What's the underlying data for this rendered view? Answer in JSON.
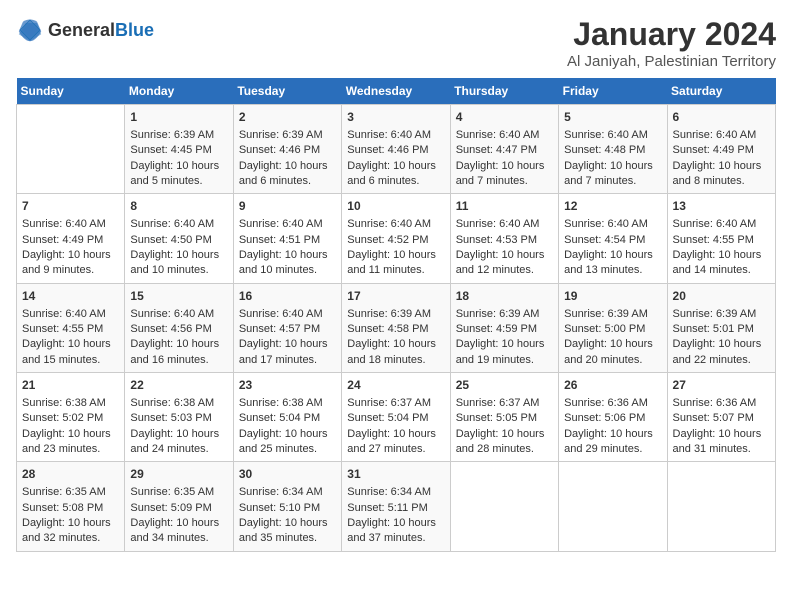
{
  "header": {
    "logo_general": "General",
    "logo_blue": "Blue",
    "month": "January 2024",
    "location": "Al Janiyah, Palestinian Territory"
  },
  "weekdays": [
    "Sunday",
    "Monday",
    "Tuesday",
    "Wednesday",
    "Thursday",
    "Friday",
    "Saturday"
  ],
  "weeks": [
    [
      {
        "day": "",
        "info": ""
      },
      {
        "day": "1",
        "info": "Sunrise: 6:39 AM\nSunset: 4:45 PM\nDaylight: 10 hours\nand 5 minutes."
      },
      {
        "day": "2",
        "info": "Sunrise: 6:39 AM\nSunset: 4:46 PM\nDaylight: 10 hours\nand 6 minutes."
      },
      {
        "day": "3",
        "info": "Sunrise: 6:40 AM\nSunset: 4:46 PM\nDaylight: 10 hours\nand 6 minutes."
      },
      {
        "day": "4",
        "info": "Sunrise: 6:40 AM\nSunset: 4:47 PM\nDaylight: 10 hours\nand 7 minutes."
      },
      {
        "day": "5",
        "info": "Sunrise: 6:40 AM\nSunset: 4:48 PM\nDaylight: 10 hours\nand 7 minutes."
      },
      {
        "day": "6",
        "info": "Sunrise: 6:40 AM\nSunset: 4:49 PM\nDaylight: 10 hours\nand 8 minutes."
      }
    ],
    [
      {
        "day": "7",
        "info": "Sunrise: 6:40 AM\nSunset: 4:49 PM\nDaylight: 10 hours\nand 9 minutes."
      },
      {
        "day": "8",
        "info": "Sunrise: 6:40 AM\nSunset: 4:50 PM\nDaylight: 10 hours\nand 10 minutes."
      },
      {
        "day": "9",
        "info": "Sunrise: 6:40 AM\nSunset: 4:51 PM\nDaylight: 10 hours\nand 10 minutes."
      },
      {
        "day": "10",
        "info": "Sunrise: 6:40 AM\nSunset: 4:52 PM\nDaylight: 10 hours\nand 11 minutes."
      },
      {
        "day": "11",
        "info": "Sunrise: 6:40 AM\nSunset: 4:53 PM\nDaylight: 10 hours\nand 12 minutes."
      },
      {
        "day": "12",
        "info": "Sunrise: 6:40 AM\nSunset: 4:54 PM\nDaylight: 10 hours\nand 13 minutes."
      },
      {
        "day": "13",
        "info": "Sunrise: 6:40 AM\nSunset: 4:55 PM\nDaylight: 10 hours\nand 14 minutes."
      }
    ],
    [
      {
        "day": "14",
        "info": "Sunrise: 6:40 AM\nSunset: 4:55 PM\nDaylight: 10 hours\nand 15 minutes."
      },
      {
        "day": "15",
        "info": "Sunrise: 6:40 AM\nSunset: 4:56 PM\nDaylight: 10 hours\nand 16 minutes."
      },
      {
        "day": "16",
        "info": "Sunrise: 6:40 AM\nSunset: 4:57 PM\nDaylight: 10 hours\nand 17 minutes."
      },
      {
        "day": "17",
        "info": "Sunrise: 6:39 AM\nSunset: 4:58 PM\nDaylight: 10 hours\nand 18 minutes."
      },
      {
        "day": "18",
        "info": "Sunrise: 6:39 AM\nSunset: 4:59 PM\nDaylight: 10 hours\nand 19 minutes."
      },
      {
        "day": "19",
        "info": "Sunrise: 6:39 AM\nSunset: 5:00 PM\nDaylight: 10 hours\nand 20 minutes."
      },
      {
        "day": "20",
        "info": "Sunrise: 6:39 AM\nSunset: 5:01 PM\nDaylight: 10 hours\nand 22 minutes."
      }
    ],
    [
      {
        "day": "21",
        "info": "Sunrise: 6:38 AM\nSunset: 5:02 PM\nDaylight: 10 hours\nand 23 minutes."
      },
      {
        "day": "22",
        "info": "Sunrise: 6:38 AM\nSunset: 5:03 PM\nDaylight: 10 hours\nand 24 minutes."
      },
      {
        "day": "23",
        "info": "Sunrise: 6:38 AM\nSunset: 5:04 PM\nDaylight: 10 hours\nand 25 minutes."
      },
      {
        "day": "24",
        "info": "Sunrise: 6:37 AM\nSunset: 5:04 PM\nDaylight: 10 hours\nand 27 minutes."
      },
      {
        "day": "25",
        "info": "Sunrise: 6:37 AM\nSunset: 5:05 PM\nDaylight: 10 hours\nand 28 minutes."
      },
      {
        "day": "26",
        "info": "Sunrise: 6:36 AM\nSunset: 5:06 PM\nDaylight: 10 hours\nand 29 minutes."
      },
      {
        "day": "27",
        "info": "Sunrise: 6:36 AM\nSunset: 5:07 PM\nDaylight: 10 hours\nand 31 minutes."
      }
    ],
    [
      {
        "day": "28",
        "info": "Sunrise: 6:35 AM\nSunset: 5:08 PM\nDaylight: 10 hours\nand 32 minutes."
      },
      {
        "day": "29",
        "info": "Sunrise: 6:35 AM\nSunset: 5:09 PM\nDaylight: 10 hours\nand 34 minutes."
      },
      {
        "day": "30",
        "info": "Sunrise: 6:34 AM\nSunset: 5:10 PM\nDaylight: 10 hours\nand 35 minutes."
      },
      {
        "day": "31",
        "info": "Sunrise: 6:34 AM\nSunset: 5:11 PM\nDaylight: 10 hours\nand 37 minutes."
      },
      {
        "day": "",
        "info": ""
      },
      {
        "day": "",
        "info": ""
      },
      {
        "day": "",
        "info": ""
      }
    ]
  ]
}
